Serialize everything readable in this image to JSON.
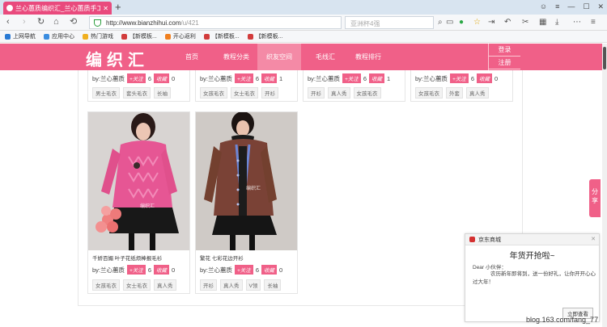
{
  "browser": {
    "tab_title": "兰心蕙质编织汇_兰心蕙质手工",
    "url_host": "http://www.bianzhihui.com",
    "url_path": "/u/421",
    "search_placeholder": "亚洲杯4强",
    "new_tab": "+",
    "bookmarks": [
      {
        "label": "上网导航",
        "color": "#2a7ad4"
      },
      {
        "label": "应用中心",
        "color": "#3b8de0"
      },
      {
        "label": "热门游戏",
        "color": "#f0b020"
      },
      {
        "label": "【新模板...",
        "color": "#d23c3c"
      },
      {
        "label": "开心返利",
        "color": "#f08020"
      },
      {
        "label": "【新模板...",
        "color": "#d23c3c"
      },
      {
        "label": "【新模板...",
        "color": "#d23c3c"
      }
    ]
  },
  "site": {
    "logo": "编织汇",
    "nav": [
      "首页",
      "教程分类",
      "织友空间",
      "毛线汇",
      "教程排行"
    ],
    "login": "登录",
    "register": "注册",
    "share": "分享"
  },
  "top_cards": [
    {
      "by": "by:兰心蕙质",
      "follow": "+关注",
      "follow_count": "6",
      "collect": "收藏",
      "collect_count": "0",
      "tags": [
        "男士毛衣",
        "套头毛衣",
        "长袖"
      ]
    },
    {
      "by": "by:兰心蕙质",
      "follow": "+关注",
      "follow_count": "6",
      "collect": "收藏",
      "collect_count": "1",
      "tags": [
        "女孩毛衣",
        "女士毛衣",
        "开衫"
      ]
    },
    {
      "by": "by:兰心蕙质",
      "follow": "+关注",
      "follow_count": "6",
      "collect": "收藏",
      "collect_count": "1",
      "tags": [
        "开衫",
        "真人秀",
        "女孩毛衣"
      ]
    },
    {
      "by": "by:兰心蕙质",
      "follow": "+关注",
      "follow_count": "6",
      "collect": "收藏",
      "collect_count": "0",
      "tags": [
        "女孩毛衣",
        "外套",
        "真人秀"
      ]
    }
  ],
  "cards": [
    {
      "caption": "千娇百媚 叶子花纸烦棒报毛衫",
      "by": "by:兰心蕙质",
      "follow": "+关注",
      "follow_count": "6",
      "collect": "收藏",
      "collect_count": "0",
      "tags": [
        "女孩毛衣",
        "女士毛衣",
        "真人秀"
      ]
    },
    {
      "caption": "繁花 七彩花边开衫",
      "by": "by:兰心蕙质",
      "follow": "+关注",
      "follow_count": "6",
      "collect": "收藏",
      "collect_count": "0",
      "tags": [
        "开衫",
        "真人秀",
        "V领",
        "长袖"
      ]
    }
  ],
  "popup": {
    "source": "京东商城",
    "title": "年货开抢啦~",
    "greeting": "Dear 小伙伴：",
    "body": "农历新年即将到，送一份好礼，让你开开心心过大年！",
    "button": "立即查看"
  },
  "watermark": "blog.163.com/fang_77"
}
